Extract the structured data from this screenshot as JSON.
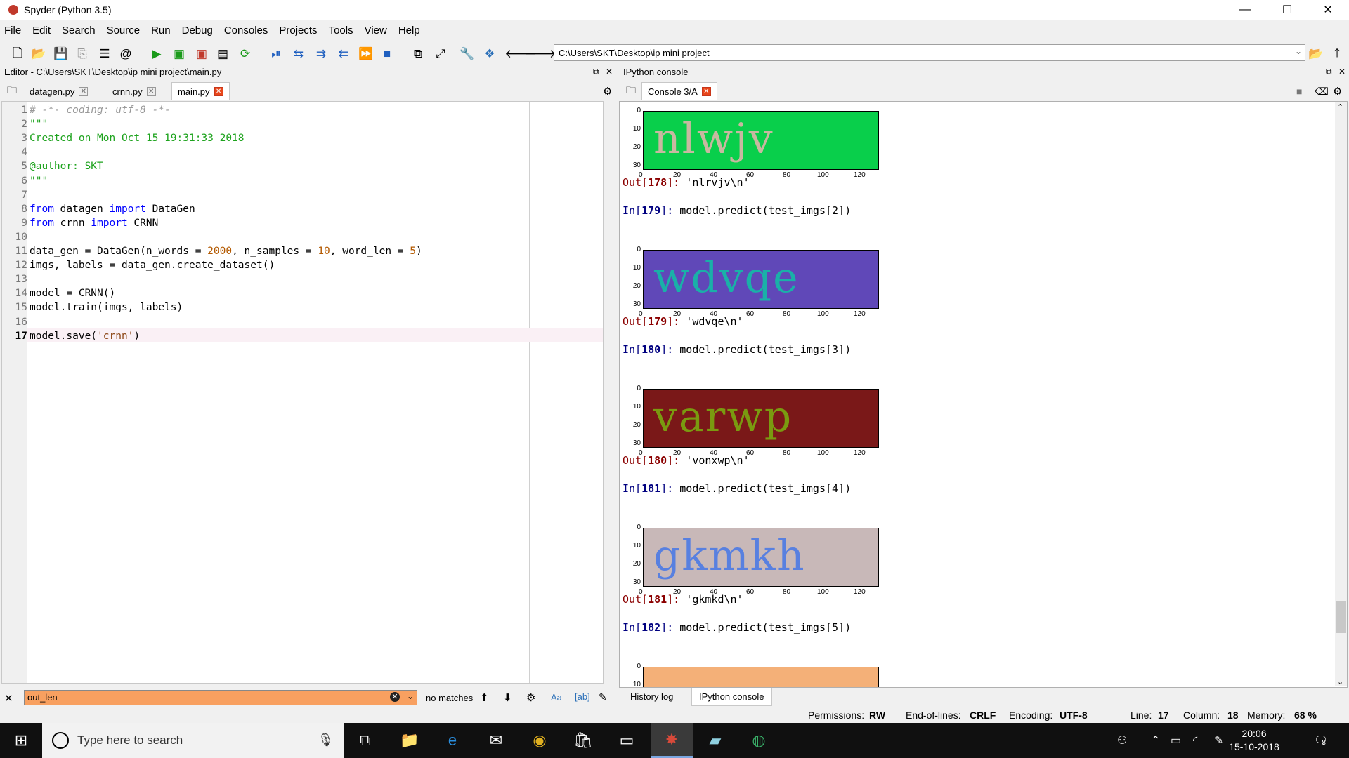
{
  "window": {
    "title": "Spyder (Python 3.5)",
    "controls": [
      "—",
      "☐",
      "✕"
    ]
  },
  "menu": [
    "File",
    "Edit",
    "Search",
    "Source",
    "Run",
    "Debug",
    "Consoles",
    "Projects",
    "Tools",
    "View",
    "Help"
  ],
  "toolbar": {
    "path": "C:\\Users\\SKT\\Desktop\\ip mini project",
    "icons": [
      "new-file-icon",
      "open-folder-icon",
      "save-icon",
      "save-all-icon",
      "outline-icon",
      "at-icon",
      "run-icon",
      "run-cell-icon",
      "run-cell-advance-icon",
      "run-selection-icon",
      "rerun-icon",
      "debug-icon",
      "step-icon",
      "step-into-icon",
      "step-return-icon",
      "continue-icon",
      "stop-icon",
      "maximize-pane-icon",
      "fullscreen-icon",
      "preferences-wrench-icon",
      "python-path-icon",
      "back-arrow-icon",
      "forward-arrow-icon",
      "browse-folder-icon",
      "parent-directory-icon"
    ]
  },
  "editor": {
    "header": "Editor - C:\\Users\\SKT\\Desktop\\ip mini project\\main.py",
    "tabs": [
      "datagen.py",
      "crnn.py",
      "main.py"
    ],
    "active_tab": "main.py",
    "current_line": 17,
    "lines": [
      {
        "n": "1",
        "t": "# -*- coding: utf-8 -*-"
      },
      {
        "n": "2",
        "t": "\"\"\""
      },
      {
        "n": "3",
        "t": "Created on Mon Oct 15 19:31:33 2018"
      },
      {
        "n": "4",
        "t": ""
      },
      {
        "n": "5",
        "t": "@author: SKT"
      },
      {
        "n": "6",
        "t": "\"\"\""
      },
      {
        "n": "7",
        "t": ""
      },
      {
        "n": "8",
        "t": "from datagen import DataGen"
      },
      {
        "n": "9",
        "t": "from crnn import CRNN"
      },
      {
        "n": "10",
        "t": ""
      },
      {
        "n": "11",
        "t": "data_gen = DataGen(n_words = 2000, n_samples = 10, word_len = 5)"
      },
      {
        "n": "12",
        "t": "imgs, labels = data_gen.create_dataset()"
      },
      {
        "n": "13",
        "t": ""
      },
      {
        "n": "14",
        "t": "model = CRNN()"
      },
      {
        "n": "15",
        "t": "model.train(imgs, labels)"
      },
      {
        "n": "16",
        "t": ""
      },
      {
        "n": "17",
        "t": "model.save('crnn')"
      }
    ]
  },
  "console": {
    "header": "IPython console",
    "tab": "Console 3/A",
    "axis_y_ticks": [
      "0",
      "10",
      "20",
      "30"
    ],
    "axis_x_ticks": [
      "0",
      "20",
      "40",
      "60",
      "80",
      "100",
      "120"
    ],
    "blocks": [
      {
        "image_word": "nlwjv",
        "bg": "#09cf4b",
        "fg": "#c8b8a0",
        "out_no": "178",
        "out_val": "'nlrvjv\\n'",
        "next_in": "179",
        "next_cmd": "model.predict(test_imgs[2])"
      },
      {
        "image_word": "wdvqe",
        "bg": "#6048b8",
        "fg": "#1ab0a8",
        "out_no": "179",
        "out_val": "'wdvqe\\n'",
        "next_in": "180",
        "next_cmd": "model.predict(test_imgs[3])"
      },
      {
        "image_word": "varwp",
        "bg": "#7a1818",
        "fg": "#7a9a10",
        "out_no": "180",
        "out_val": "'vonxwp\\n'",
        "next_in": "181",
        "next_cmd": "model.predict(test_imgs[4])"
      },
      {
        "image_word": "gkmkh",
        "bg": "#c8b8b8",
        "fg": "#5880e0",
        "out_no": "181",
        "out_val": "'gkmkd\\n'",
        "next_in": "182",
        "next_cmd": "model.predict(test_imgs[5])"
      }
    ],
    "last_image_bg": "#f4b078",
    "prompt_out": "Out",
    "prompt_in": "In"
  },
  "find": {
    "value": "out_len",
    "status": "no matches"
  },
  "bottom_tabs": [
    "History log",
    "IPython console"
  ],
  "status": {
    "permissions_label": "Permissions:",
    "permissions": "RW",
    "eol_label": "End-of-lines:",
    "eol": "CRLF",
    "encoding_label": "Encoding:",
    "encoding": "UTF-8",
    "line_label": "Line:",
    "line": "17",
    "column_label": "Column:",
    "column": "18",
    "memory_label": "Memory:",
    "memory": "68 %"
  },
  "taskbar": {
    "search_placeholder": "Type here to search",
    "time": "20:06",
    "date": "15-10-2018",
    "notification_count": "8"
  }
}
